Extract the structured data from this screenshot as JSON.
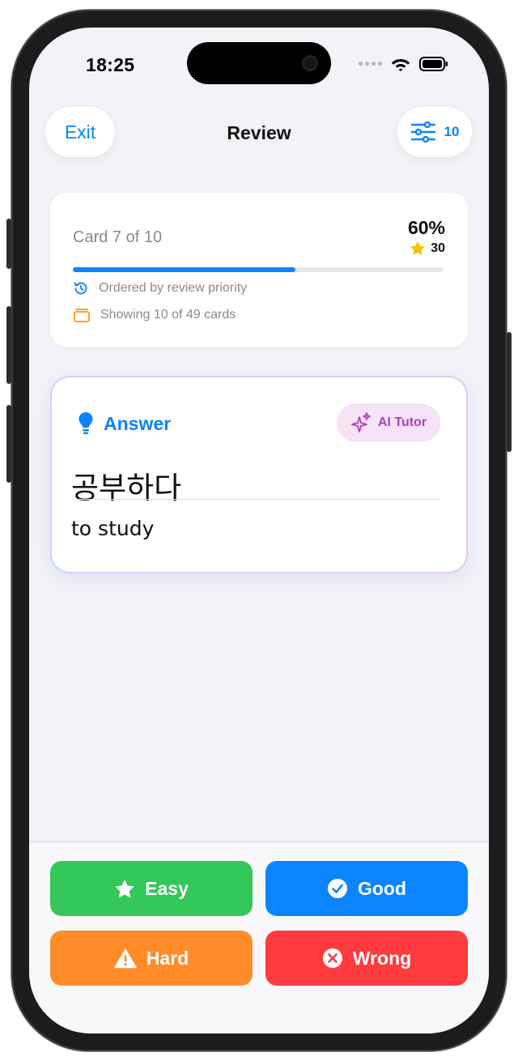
{
  "status_bar": {
    "time": "18:25"
  },
  "nav": {
    "exit_label": "Exit",
    "title": "Review",
    "filter_count": "10"
  },
  "progress": {
    "card_label": "Card 7 of 10",
    "percent_label": "60%",
    "stars": "30",
    "fraction": 0.6,
    "order_note": "Ordered by review priority",
    "showing_note": "Showing 10 of 49 cards"
  },
  "answer": {
    "heading": "Answer",
    "ai_tutor_label": "AI Tutor",
    "term": "공부하다",
    "meaning": "to study"
  },
  "actions": {
    "easy": "Easy",
    "good": "Good",
    "hard": "Hard",
    "wrong": "Wrong"
  },
  "colors": {
    "accent": "#0a84ff",
    "easy": "#34c759",
    "good": "#0a84ff",
    "hard": "#ff8c28",
    "wrong": "#ff3b3f",
    "ai": "#b43cc8",
    "star": "#f5c400"
  },
  "icons": {
    "filter": "sliders-icon",
    "star": "star-icon",
    "history": "clock-arrow-icon",
    "deck": "card-stack-icon",
    "hint": "lightbulb-icon",
    "ai": "sparkles-icon",
    "good": "checkmark-circle-icon",
    "hard": "warning-triangle-icon",
    "wrong": "x-circle-icon"
  }
}
